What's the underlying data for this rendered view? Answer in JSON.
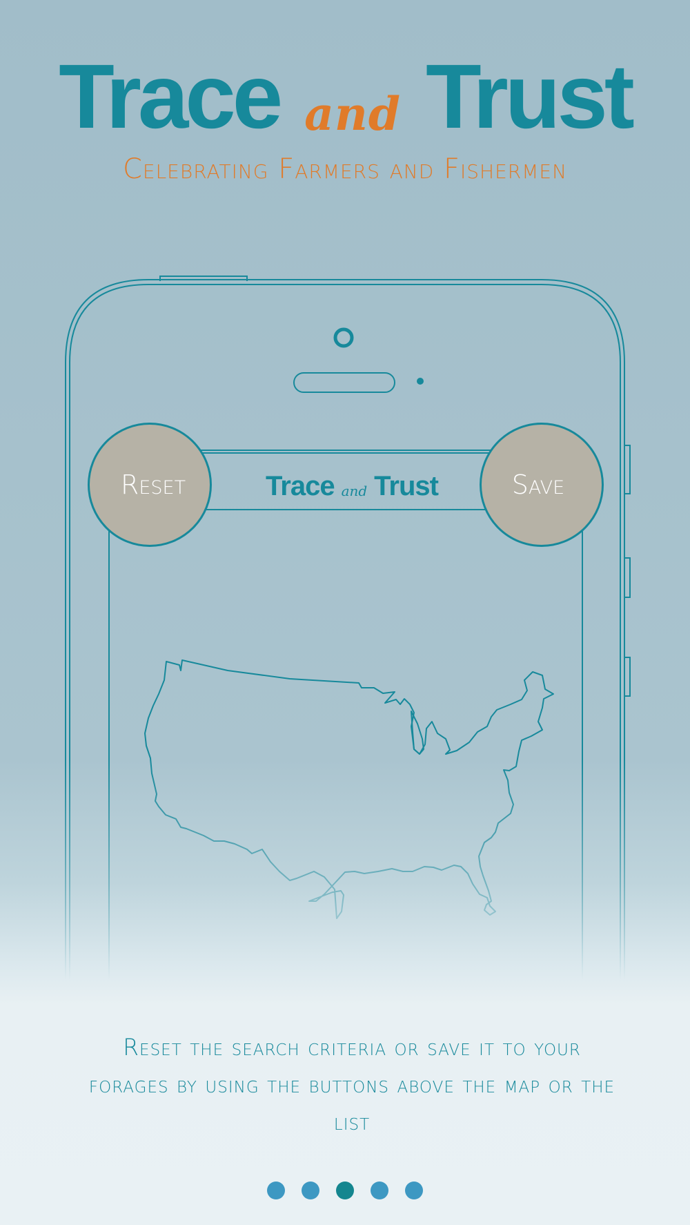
{
  "header": {
    "title_word_1": "Trace",
    "title_and": "and",
    "title_word_2": "Trust",
    "tagline": "Celebrating Farmers and Fishermen"
  },
  "phone": {
    "app_bar": {
      "logo_word_1": "Trace",
      "logo_and": "and",
      "logo_word_2": "Trust",
      "reset_label": "Reset",
      "save_label": "Save"
    },
    "map_icon": "usa-map-outline-icon"
  },
  "description": "Reset the search criteria or save it to your forages by using the buttons above the map or the list",
  "pagination": {
    "total_pages": 5,
    "active_page": 3
  },
  "colors": {
    "teal": "#17899b",
    "orange": "#e07b2a",
    "button_fill": "#b6b2a6",
    "dot": "#3d98c2",
    "dot_active": "#14868f"
  }
}
